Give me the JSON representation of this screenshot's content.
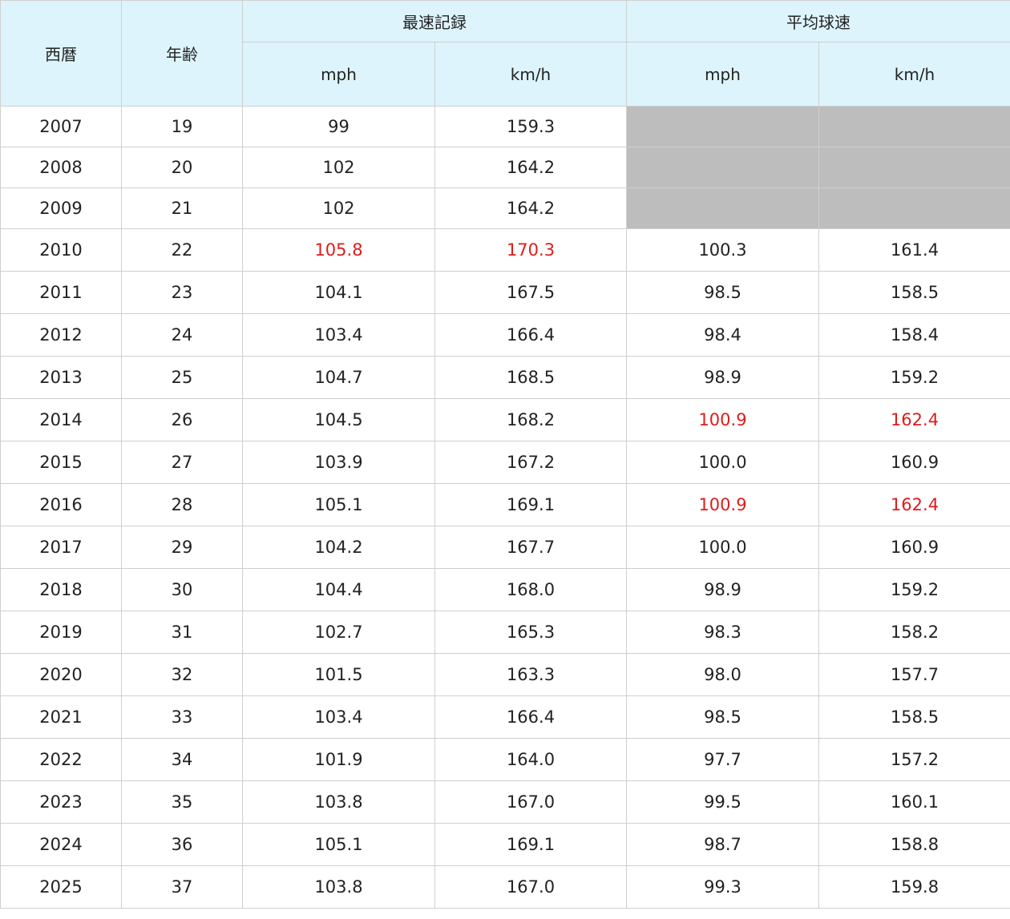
{
  "headers": {
    "year": "西暦",
    "age": "年齢",
    "max_speed": "最速記録",
    "avg_speed": "平均球速",
    "mph": "mph",
    "kmh": "km/h"
  },
  "colors": {
    "header_bg": "#ddf4fc",
    "highlight_text": "#e01b1b",
    "no_data_fill": "#bdbdbd"
  },
  "rows": [
    {
      "year": "2007",
      "age": "19",
      "max_mph": "99",
      "max_kmh": "159.3",
      "avg_mph": "",
      "avg_kmh": ""
    },
    {
      "year": "2008",
      "age": "20",
      "max_mph": "102",
      "max_kmh": "164.2",
      "avg_mph": "",
      "avg_kmh": ""
    },
    {
      "year": "2009",
      "age": "21",
      "max_mph": "102",
      "max_kmh": "164.2",
      "avg_mph": "",
      "avg_kmh": ""
    },
    {
      "year": "2010",
      "age": "22",
      "max_mph": "105.8",
      "max_kmh": "170.3",
      "avg_mph": "100.3",
      "avg_kmh": "161.4"
    },
    {
      "year": "2011",
      "age": "23",
      "max_mph": "104.1",
      "max_kmh": "167.5",
      "avg_mph": "98.5",
      "avg_kmh": "158.5"
    },
    {
      "year": "2012",
      "age": "24",
      "max_mph": "103.4",
      "max_kmh": "166.4",
      "avg_mph": "98.4",
      "avg_kmh": "158.4"
    },
    {
      "year": "2013",
      "age": "25",
      "max_mph": "104.7",
      "max_kmh": "168.5",
      "avg_mph": "98.9",
      "avg_kmh": "159.2"
    },
    {
      "year": "2014",
      "age": "26",
      "max_mph": "104.5",
      "max_kmh": "168.2",
      "avg_mph": "100.9",
      "avg_kmh": "162.4"
    },
    {
      "year": "2015",
      "age": "27",
      "max_mph": "103.9",
      "max_kmh": "167.2",
      "avg_mph": "100.0",
      "avg_kmh": "160.9"
    },
    {
      "year": "2016",
      "age": "28",
      "max_mph": "105.1",
      "max_kmh": "169.1",
      "avg_mph": "100.9",
      "avg_kmh": "162.4"
    },
    {
      "year": "2017",
      "age": "29",
      "max_mph": "104.2",
      "max_kmh": "167.7",
      "avg_mph": "100.0",
      "avg_kmh": "160.9"
    },
    {
      "year": "2018",
      "age": "30",
      "max_mph": "104.4",
      "max_kmh": "168.0",
      "avg_mph": "98.9",
      "avg_kmh": "159.2"
    },
    {
      "year": "2019",
      "age": "31",
      "max_mph": "102.7",
      "max_kmh": "165.3",
      "avg_mph": "98.3",
      "avg_kmh": "158.2"
    },
    {
      "year": "2020",
      "age": "32",
      "max_mph": "101.5",
      "max_kmh": "163.3",
      "avg_mph": "98.0",
      "avg_kmh": "157.7"
    },
    {
      "year": "2021",
      "age": "33",
      "max_mph": "103.4",
      "max_kmh": "166.4",
      "avg_mph": "98.5",
      "avg_kmh": "158.5"
    },
    {
      "year": "2022",
      "age": "34",
      "max_mph": "101.9",
      "max_kmh": "164.0",
      "avg_mph": "97.7",
      "avg_kmh": "157.2"
    },
    {
      "year": "2023",
      "age": "35",
      "max_mph": "103.8",
      "max_kmh": "167.0",
      "avg_mph": "99.5",
      "avg_kmh": "160.1"
    },
    {
      "year": "2024",
      "age": "36",
      "max_mph": "105.1",
      "max_kmh": "169.1",
      "avg_mph": "98.7",
      "avg_kmh": "158.8"
    },
    {
      "year": "2025",
      "age": "37",
      "max_mph": "103.8",
      "max_kmh": "167.0",
      "avg_mph": "99.3",
      "avg_kmh": "159.8"
    }
  ]
}
